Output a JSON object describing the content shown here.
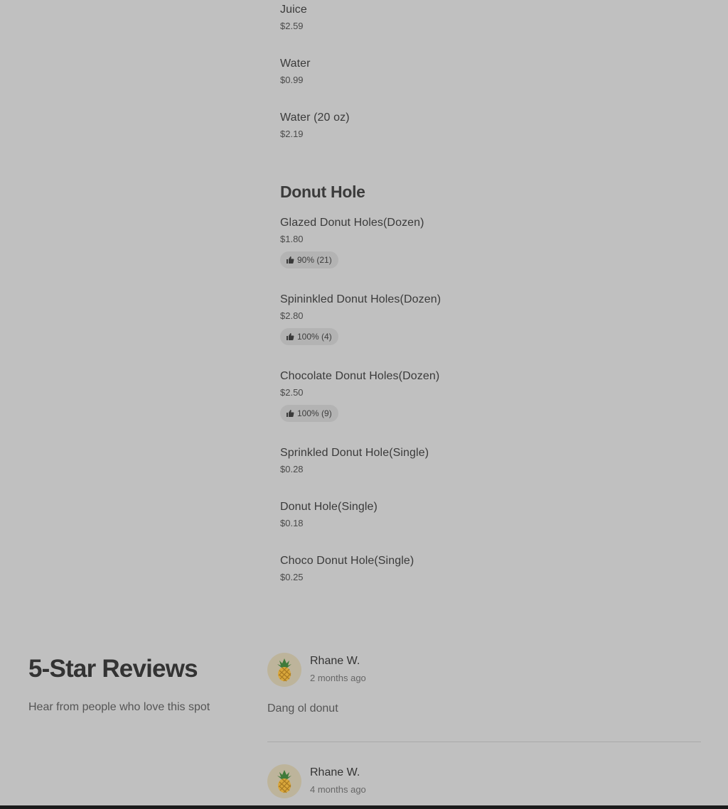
{
  "menu": {
    "drinks": [
      {
        "name": "Juice",
        "price": "$2.59"
      },
      {
        "name": "Water",
        "price": "$0.99"
      },
      {
        "name": "Water (20 oz)",
        "price": "$2.19"
      }
    ],
    "donut_hole_section": {
      "title": "Donut Hole",
      "items": [
        {
          "name": "Glazed Donut Holes(Dozen)",
          "price": "$1.80",
          "rating": "90% (21)"
        },
        {
          "name": "Spininkled Donut Holes(Dozen)",
          "price": "$2.80",
          "rating": "100% (4)"
        },
        {
          "name": "Chocolate Donut Holes(Dozen)",
          "price": "$2.50",
          "rating": "100% (9)"
        },
        {
          "name": "Sprinkled Donut Hole(Single)",
          "price": "$0.28"
        },
        {
          "name": "Donut Hole(Single)",
          "price": "$0.18"
        },
        {
          "name": "Choco Donut Hole(Single)",
          "price": "$0.25"
        }
      ]
    }
  },
  "reviews": {
    "title": "5-Star Reviews",
    "subtitle": "Hear from people who love this spot",
    "items": [
      {
        "name": "Rhane W.",
        "time": "2 months ago",
        "text": "Dang ol donut",
        "avatar_icon": "pineapple-icon"
      },
      {
        "name": "Rhane W.",
        "time": "4 months ago",
        "avatar_icon": "pineapple-icon"
      }
    ]
  },
  "colors": {
    "background": "#c0c0c0",
    "badge": "#b3b3b3",
    "text": "#363636"
  }
}
